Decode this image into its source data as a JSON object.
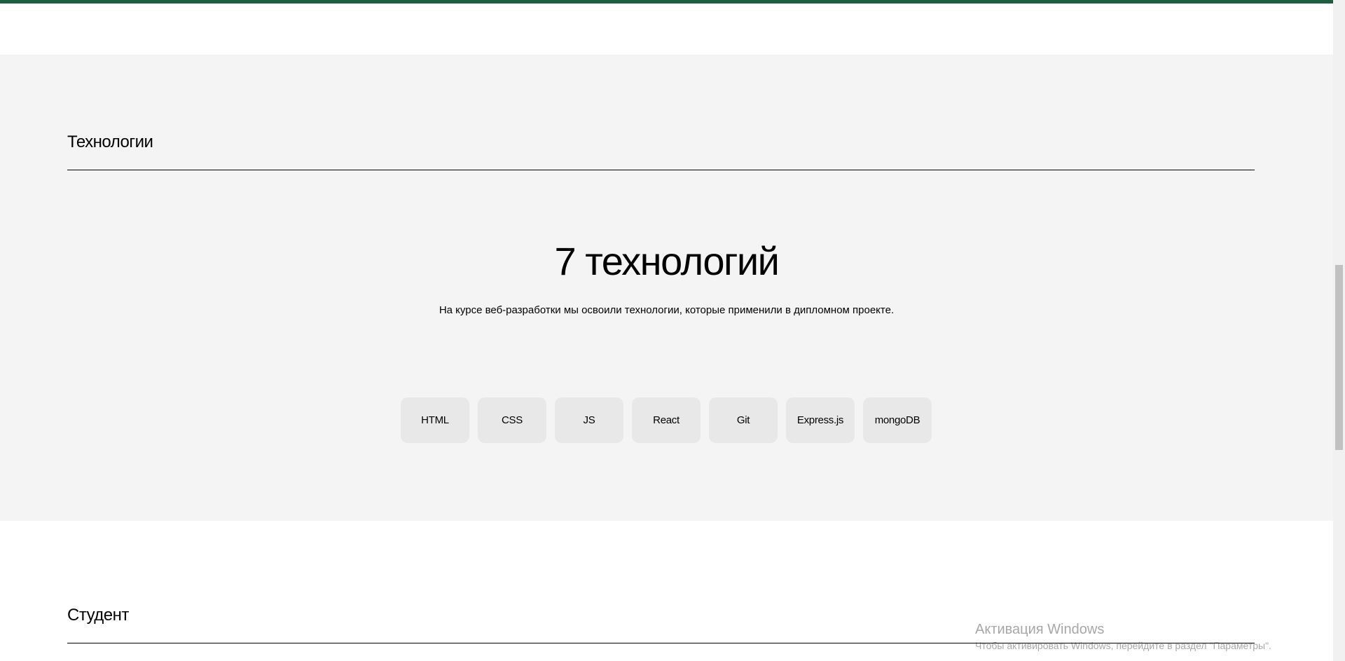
{
  "techs": {
    "section_title": "Технологии",
    "heading": "7 технологий",
    "subtitle": "На курсе веб-разработки мы освоили технологии, которые применили в дипломном проекте.",
    "items": [
      "HTML",
      "CSS",
      "JS",
      "React",
      "Git",
      "Express.js",
      "mongoDB"
    ]
  },
  "student": {
    "section_title": "Студент"
  },
  "windows_activation": {
    "title": "Активация Windows",
    "text": "Чтобы активировать Windows, перейдите в раздел \"Параметры\"."
  },
  "colors": {
    "top_bar": "#1e5e40",
    "techs_background": "#f4f4f4",
    "tech_item_background": "#e8e8e8"
  }
}
